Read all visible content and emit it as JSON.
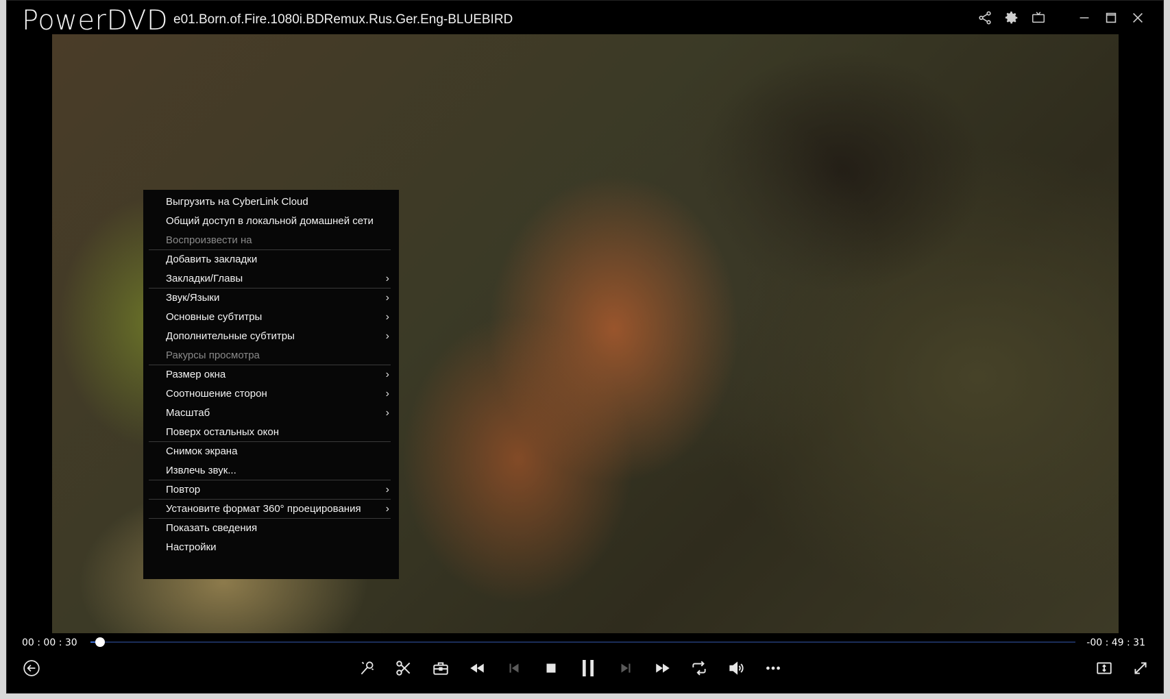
{
  "window": {
    "app_name": "PowerDVD",
    "file_title": "e01.Born.of.Fire.1080i.BDRemux.Rus.Ger.Eng-BLUEBIRD"
  },
  "title_controls": [
    {
      "icon": "share-icon"
    },
    {
      "icon": "gear-icon"
    },
    {
      "icon": "tv-icon"
    },
    {
      "icon": "minimize-icon"
    },
    {
      "icon": "maximize-icon"
    },
    {
      "icon": "close-icon"
    }
  ],
  "context_menu": {
    "items": [
      {
        "label": "Выгрузить на CyberLink Cloud",
        "enabled": true,
        "submenu": false,
        "separator_after": false
      },
      {
        "label": "Общий доступ в локальной домашней сети",
        "enabled": true,
        "submenu": false,
        "separator_after": false
      },
      {
        "label": "Воспроизвести на",
        "enabled": false,
        "submenu": false,
        "separator_after": true
      },
      {
        "label": "Добавить закладки",
        "enabled": true,
        "submenu": false,
        "separator_after": false
      },
      {
        "label": "Закладки/Главы",
        "enabled": true,
        "submenu": true,
        "separator_after": true
      },
      {
        "label": "Звук/Языки",
        "enabled": true,
        "submenu": true,
        "separator_after": false
      },
      {
        "label": "Основные субтитры",
        "enabled": true,
        "submenu": true,
        "separator_after": false
      },
      {
        "label": "Дополнительные субтитры",
        "enabled": true,
        "submenu": true,
        "separator_after": false
      },
      {
        "label": "Ракурсы просмотра",
        "enabled": false,
        "submenu": false,
        "separator_after": true
      },
      {
        "label": "Размер окна",
        "enabled": true,
        "submenu": true,
        "separator_after": false
      },
      {
        "label": "Соотношение сторон",
        "enabled": true,
        "submenu": true,
        "separator_after": false
      },
      {
        "label": "Масштаб",
        "enabled": true,
        "submenu": true,
        "separator_after": false
      },
      {
        "label": "Поверх остальных окон",
        "enabled": true,
        "submenu": false,
        "separator_after": true
      },
      {
        "label": "Снимок экрана",
        "enabled": true,
        "submenu": false,
        "separator_after": false
      },
      {
        "label": "Извлечь звук...",
        "enabled": true,
        "submenu": false,
        "separator_after": true
      },
      {
        "label": "Повтор",
        "enabled": true,
        "submenu": true,
        "separator_after": true
      },
      {
        "label": "Установите формат 360° проецирования",
        "enabled": true,
        "submenu": true,
        "separator_after": true
      },
      {
        "label": "Показать сведения",
        "enabled": true,
        "submenu": false,
        "separator_after": false
      },
      {
        "label": "Настройки",
        "enabled": true,
        "submenu": false,
        "separator_after": false
      }
    ],
    "submenu_arrow": "›"
  },
  "timeline": {
    "current_time": "00 : 00 : 30",
    "remaining_time": "-00 : 49 : 31",
    "progress_fraction": 0.01
  },
  "controls": [
    {
      "icon": "back-icon",
      "enabled": true
    },
    {
      "icon": "karaoke-mic-icon",
      "enabled": true
    },
    {
      "icon": "scissors-icon",
      "enabled": true
    },
    {
      "icon": "toolbox-icon",
      "enabled": true
    },
    {
      "icon": "rewind-icon",
      "enabled": true
    },
    {
      "icon": "previous-icon",
      "enabled": false
    },
    {
      "icon": "stop-icon",
      "enabled": true
    },
    {
      "icon": "pause-icon",
      "enabled": true
    },
    {
      "icon": "next-icon",
      "enabled": false
    },
    {
      "icon": "fast-forward-icon",
      "enabled": true
    },
    {
      "icon": "repeat-icon",
      "enabled": true
    },
    {
      "icon": "volume-icon",
      "enabled": true
    },
    {
      "icon": "more-icon",
      "enabled": true
    },
    {
      "icon": "mini-player-icon",
      "enabled": true
    },
    {
      "icon": "fullscreen-icon",
      "enabled": true
    }
  ]
}
